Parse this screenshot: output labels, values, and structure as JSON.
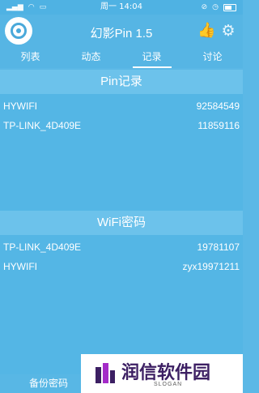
{
  "status_bar": {
    "center": "周一 14:04"
  },
  "header": {
    "title": "幻影Pin 1.5"
  },
  "tabs": [
    {
      "label": "列表"
    },
    {
      "label": "动态"
    },
    {
      "label": "记录",
      "active": true
    },
    {
      "label": "讨论"
    }
  ],
  "pin_section": {
    "title": "Pin记录",
    "rows": [
      {
        "name": "HYWIFI",
        "value": "92584549"
      },
      {
        "name": "TP-LINK_4D409E",
        "value": "11859116"
      }
    ]
  },
  "wifi_section": {
    "title": "WiFi密码",
    "rows": [
      {
        "name": "TP-LINK_4D409E",
        "value": "19781107"
      },
      {
        "name": "HYWIFI",
        "value": "zyx19971211"
      }
    ]
  },
  "footer": {
    "backup_label": "备份密码"
  },
  "watermark": {
    "text": "润信软件园",
    "sub": "SLOGAN"
  },
  "colors": {
    "background": "#5bb8e6",
    "section_header": "#6cc2eb",
    "watermark_text": "#3c1f63"
  }
}
